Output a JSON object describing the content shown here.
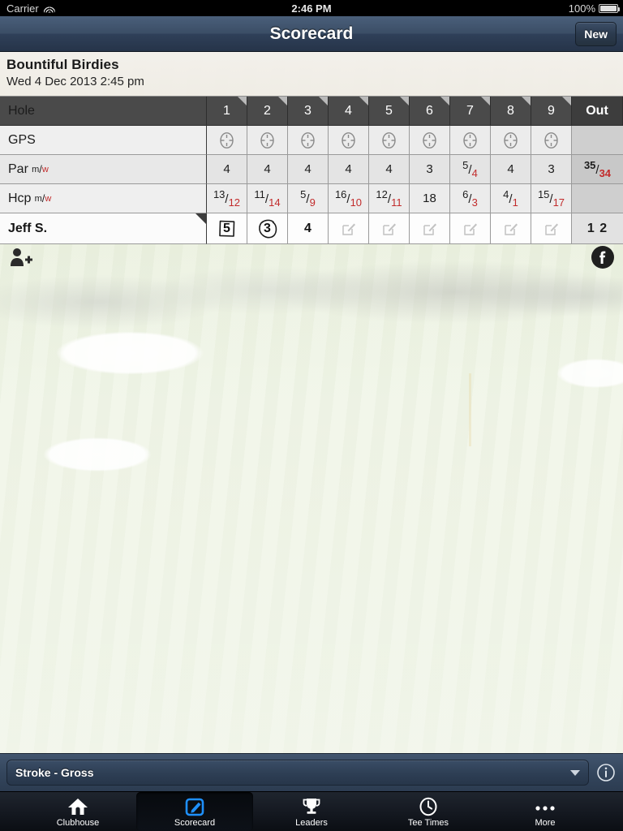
{
  "status_bar": {
    "carrier": "Carrier",
    "wifi_icon": "wifi-icon",
    "time": "2:46 PM",
    "battery_percent": "100%",
    "battery_icon": "battery-icon"
  },
  "nav_bar": {
    "title": "Scorecard",
    "new_button": "New"
  },
  "round": {
    "name": "Bountiful Birdies",
    "datetime": "Wed 4 Dec 2013 2:45 pm"
  },
  "scorecard": {
    "row_labels": {
      "hole": "Hole",
      "gps": "GPS",
      "par": "Par",
      "hcp": "Hcp",
      "mens_marker": "m",
      "slash": "/",
      "womens_marker": "w"
    },
    "holes": [
      "1",
      "2",
      "3",
      "4",
      "5",
      "6",
      "7",
      "8",
      "9"
    ],
    "out_header": "Out",
    "gps_icon": "gps-crosshair-icon",
    "par": {
      "values": [
        {
          "men": "4",
          "women": ""
        },
        {
          "men": "4",
          "women": ""
        },
        {
          "men": "4",
          "women": ""
        },
        {
          "men": "4",
          "women": ""
        },
        {
          "men": "4",
          "women": ""
        },
        {
          "men": "3",
          "women": ""
        },
        {
          "men": "5",
          "women": "4"
        },
        {
          "men": "4",
          "women": ""
        },
        {
          "men": "3",
          "women": ""
        }
      ],
      "out": {
        "men": "35",
        "women": "34"
      }
    },
    "hcp": {
      "values": [
        {
          "men": "13",
          "women": "12"
        },
        {
          "men": "11",
          "women": "14"
        },
        {
          "men": "5",
          "women": "9"
        },
        {
          "men": "16",
          "women": "10"
        },
        {
          "men": "12",
          "women": "11"
        },
        {
          "men": "18",
          "women": ""
        },
        {
          "men": "6",
          "women": "3"
        },
        {
          "men": "4",
          "women": "1"
        },
        {
          "men": "15",
          "women": "17"
        }
      ],
      "out": {
        "men": "",
        "women": ""
      }
    },
    "player": {
      "name": "Jeff S.",
      "scores": [
        {
          "value": "5",
          "mark": "square"
        },
        {
          "value": "3",
          "mark": "circle"
        },
        {
          "value": "4",
          "mark": "none"
        },
        {
          "value": "",
          "mark": "empty"
        },
        {
          "value": "",
          "mark": "empty"
        },
        {
          "value": "",
          "mark": "empty"
        },
        {
          "value": "",
          "mark": "empty"
        },
        {
          "value": "",
          "mark": "empty"
        },
        {
          "value": "",
          "mark": "empty"
        }
      ],
      "out_total": "1 2"
    }
  },
  "social": {
    "add_player_icon": "add-person-icon",
    "facebook_icon": "facebook-icon"
  },
  "bottom_bar": {
    "scoring_mode": "Stroke - Gross",
    "caret_icon": "chevron-down-icon",
    "info_icon": "info-icon"
  },
  "tab_bar": {
    "tabs": [
      {
        "label": "Clubhouse",
        "icon": "home-icon",
        "active": false
      },
      {
        "label": "Scorecard",
        "icon": "compose-icon",
        "active": true
      },
      {
        "label": "Leaders",
        "icon": "trophy-icon",
        "active": false
      },
      {
        "label": "Tee Times",
        "icon": "clock-icon",
        "active": false
      },
      {
        "label": "More",
        "icon": "ellipsis-icon",
        "active": false
      }
    ]
  },
  "colors": {
    "nav_blue": "#3b4e66",
    "accent_red": "#c22b2b",
    "active_tab_blue": "#1e90ff",
    "header_dark": "#4a4a4a"
  }
}
